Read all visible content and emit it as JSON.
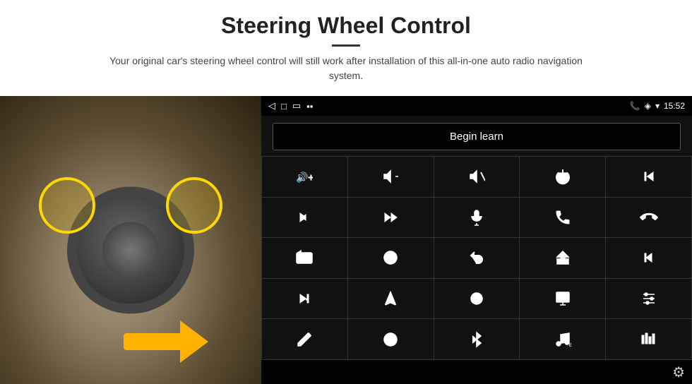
{
  "header": {
    "title": "Steering Wheel Control",
    "subtitle": "Your original car's steering wheel control will still work after installation of this all-in-one auto radio navigation system.",
    "title_underline": true
  },
  "status_bar": {
    "back_icon": "◁",
    "home_icon": "□",
    "recent_icon": "▭",
    "signal_icon": "▪▪",
    "phone_icon": "📞",
    "location_icon": "◈",
    "wifi_icon": "▾",
    "time": "15:52"
  },
  "begin_learn": {
    "label": "Begin learn"
  },
  "icons": [
    {
      "id": "vol-up",
      "symbol": "🔊+",
      "label": "Volume Up"
    },
    {
      "id": "vol-down",
      "symbol": "🔉−",
      "label": "Volume Down"
    },
    {
      "id": "mute",
      "symbol": "🔇",
      "label": "Mute"
    },
    {
      "id": "power",
      "symbol": "⏻",
      "label": "Power"
    },
    {
      "id": "prev-track",
      "symbol": "⏮",
      "label": "Previous Track"
    },
    {
      "id": "next",
      "symbol": "⏭",
      "label": "Next"
    },
    {
      "id": "fast-fwd",
      "symbol": "⏩",
      "label": "Fast Forward"
    },
    {
      "id": "mic",
      "symbol": "🎤",
      "label": "Microphone"
    },
    {
      "id": "phone",
      "symbol": "📞",
      "label": "Phone"
    },
    {
      "id": "hang-up",
      "symbol": "📵",
      "label": "Hang Up"
    },
    {
      "id": "cam",
      "symbol": "📷",
      "label": "Camera"
    },
    {
      "id": "view360",
      "symbol": "👁",
      "label": "360 View"
    },
    {
      "id": "back",
      "symbol": "↩",
      "label": "Back"
    },
    {
      "id": "home",
      "symbol": "⌂",
      "label": "Home"
    },
    {
      "id": "skip-back",
      "symbol": "⏮⏮",
      "label": "Skip Back"
    },
    {
      "id": "skip-fwd",
      "symbol": "⏭⏭",
      "label": "Skip Forward"
    },
    {
      "id": "nav",
      "symbol": "➤",
      "label": "Navigation"
    },
    {
      "id": "eq",
      "symbol": "⇌",
      "label": "Equalizer"
    },
    {
      "id": "media",
      "symbol": "📷",
      "label": "Media"
    },
    {
      "id": "settings",
      "symbol": "⚙",
      "label": "Settings"
    },
    {
      "id": "edit",
      "symbol": "✎",
      "label": "Edit"
    },
    {
      "id": "circle",
      "symbol": "◎",
      "label": "Dial"
    },
    {
      "id": "bluetooth",
      "symbol": "✦",
      "label": "Bluetooth"
    },
    {
      "id": "music",
      "symbol": "♫",
      "label": "Music"
    },
    {
      "id": "equalizer",
      "symbol": "|||",
      "label": "Equalizer Bars"
    }
  ],
  "settings": {
    "gear_icon": "⚙"
  }
}
